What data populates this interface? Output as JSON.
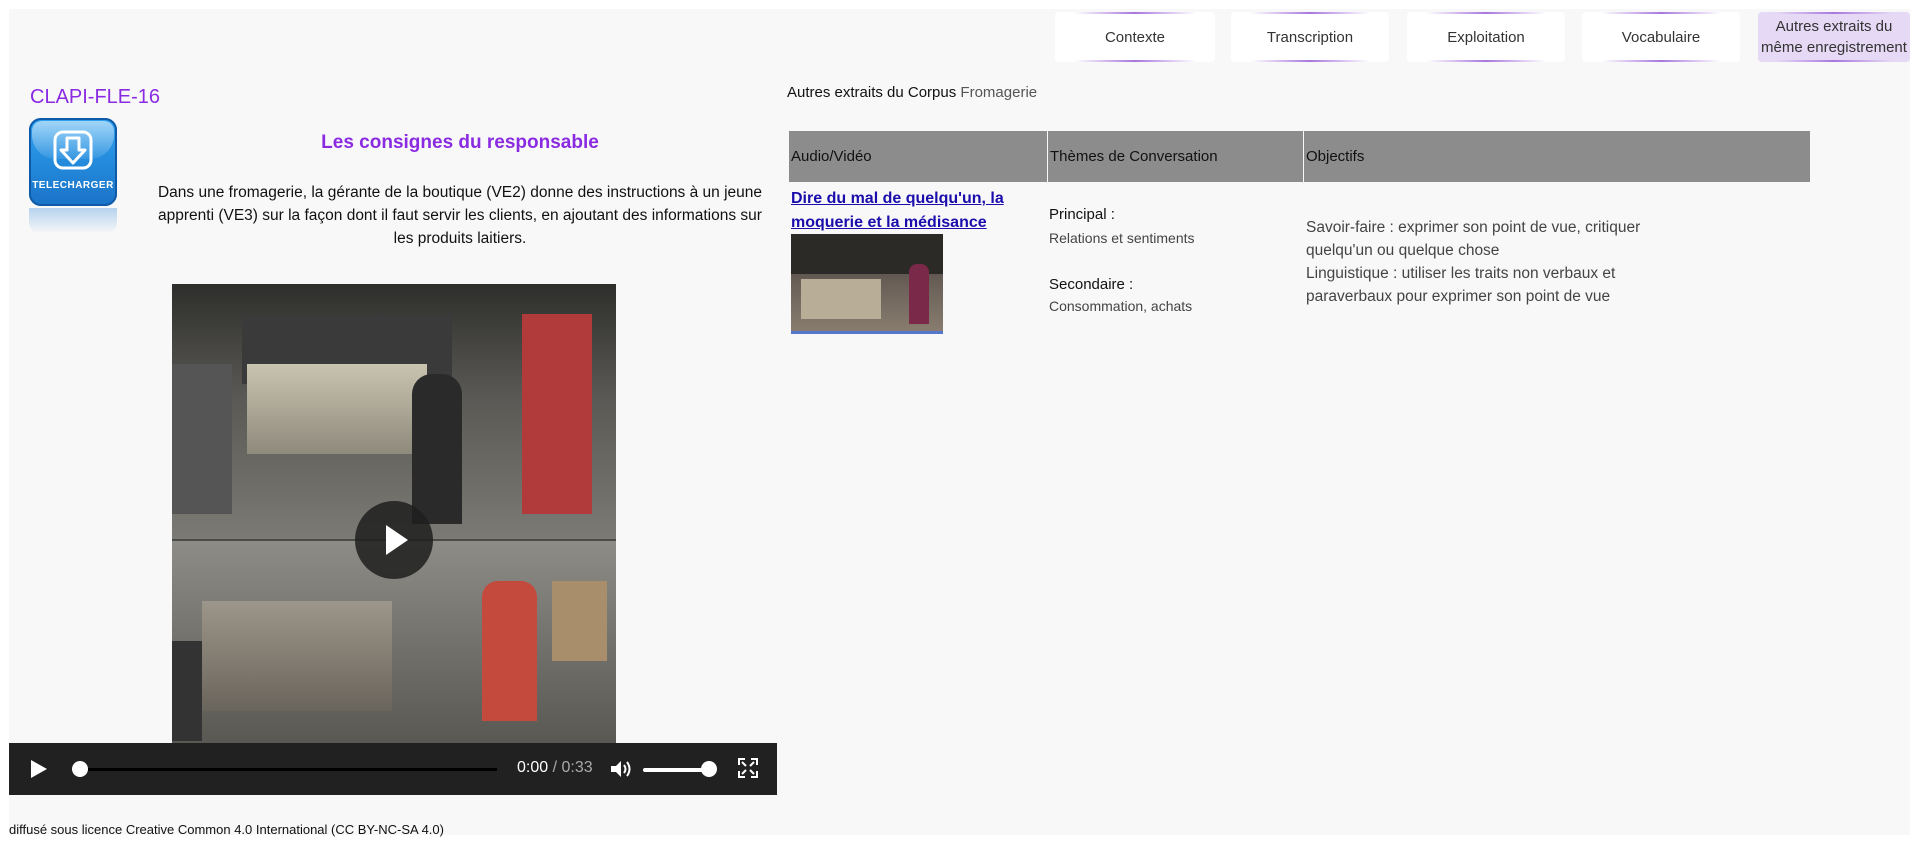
{
  "tabs": [
    {
      "label": "Contexte"
    },
    {
      "label": "Transcription"
    },
    {
      "label": "Exploitation"
    },
    {
      "label": "Vocabulaire"
    },
    {
      "label": "Autres extraits du même enregistrement",
      "active": true
    }
  ],
  "left": {
    "code": "CLAPI-FLE-16",
    "download_label": "TELECHARGER",
    "title": "Les consignes du responsable",
    "description": "Dans une fromagerie, la gérante de la boutique (VE2) donne des instructions à un jeune apprenti (VE3) sur la façon dont il faut servir les clients, en ajoutant des informations sur les produits laitiers."
  },
  "player": {
    "current_time": "0:00",
    "duration": "/ 0:33",
    "progress": 0,
    "volume": 1.0,
    "icons": [
      "play-icon",
      "volume-icon",
      "fullscreen-icon"
    ]
  },
  "license": "diffusé sous licence Creative Common 4.0 International (CC BY-NC-SA 4.0)",
  "corpus": {
    "prefix": "Autres extraits du Corpus",
    "name": "Fromagerie",
    "table": {
      "headers": [
        "Audio/Vidéo",
        "Thèmes de Conversation",
        "Objectifs"
      ],
      "rows": [
        {
          "link": "Dire du mal de quelqu'un, la moquerie et la médisance",
          "principal_label": "Principal :",
          "principal_value": "Relations et sentiments",
          "secondary_label": "Secondaire :",
          "secondary_value": "Consommation, achats",
          "objectives": "Savoir-faire : exprimer son point de vue, critiquer quelqu'un ou quelque chose\nLinguistique : utiliser les traits non verbaux et paraverbaux pour exprimer son point de vue"
        }
      ]
    }
  },
  "colors": {
    "accent_purple": "#8a2be2",
    "active_tab_bg": "#e6d9f5",
    "header_gray": "#8c8c8c",
    "link_blue": "#1a0dab",
    "player_bg": "#212121"
  }
}
